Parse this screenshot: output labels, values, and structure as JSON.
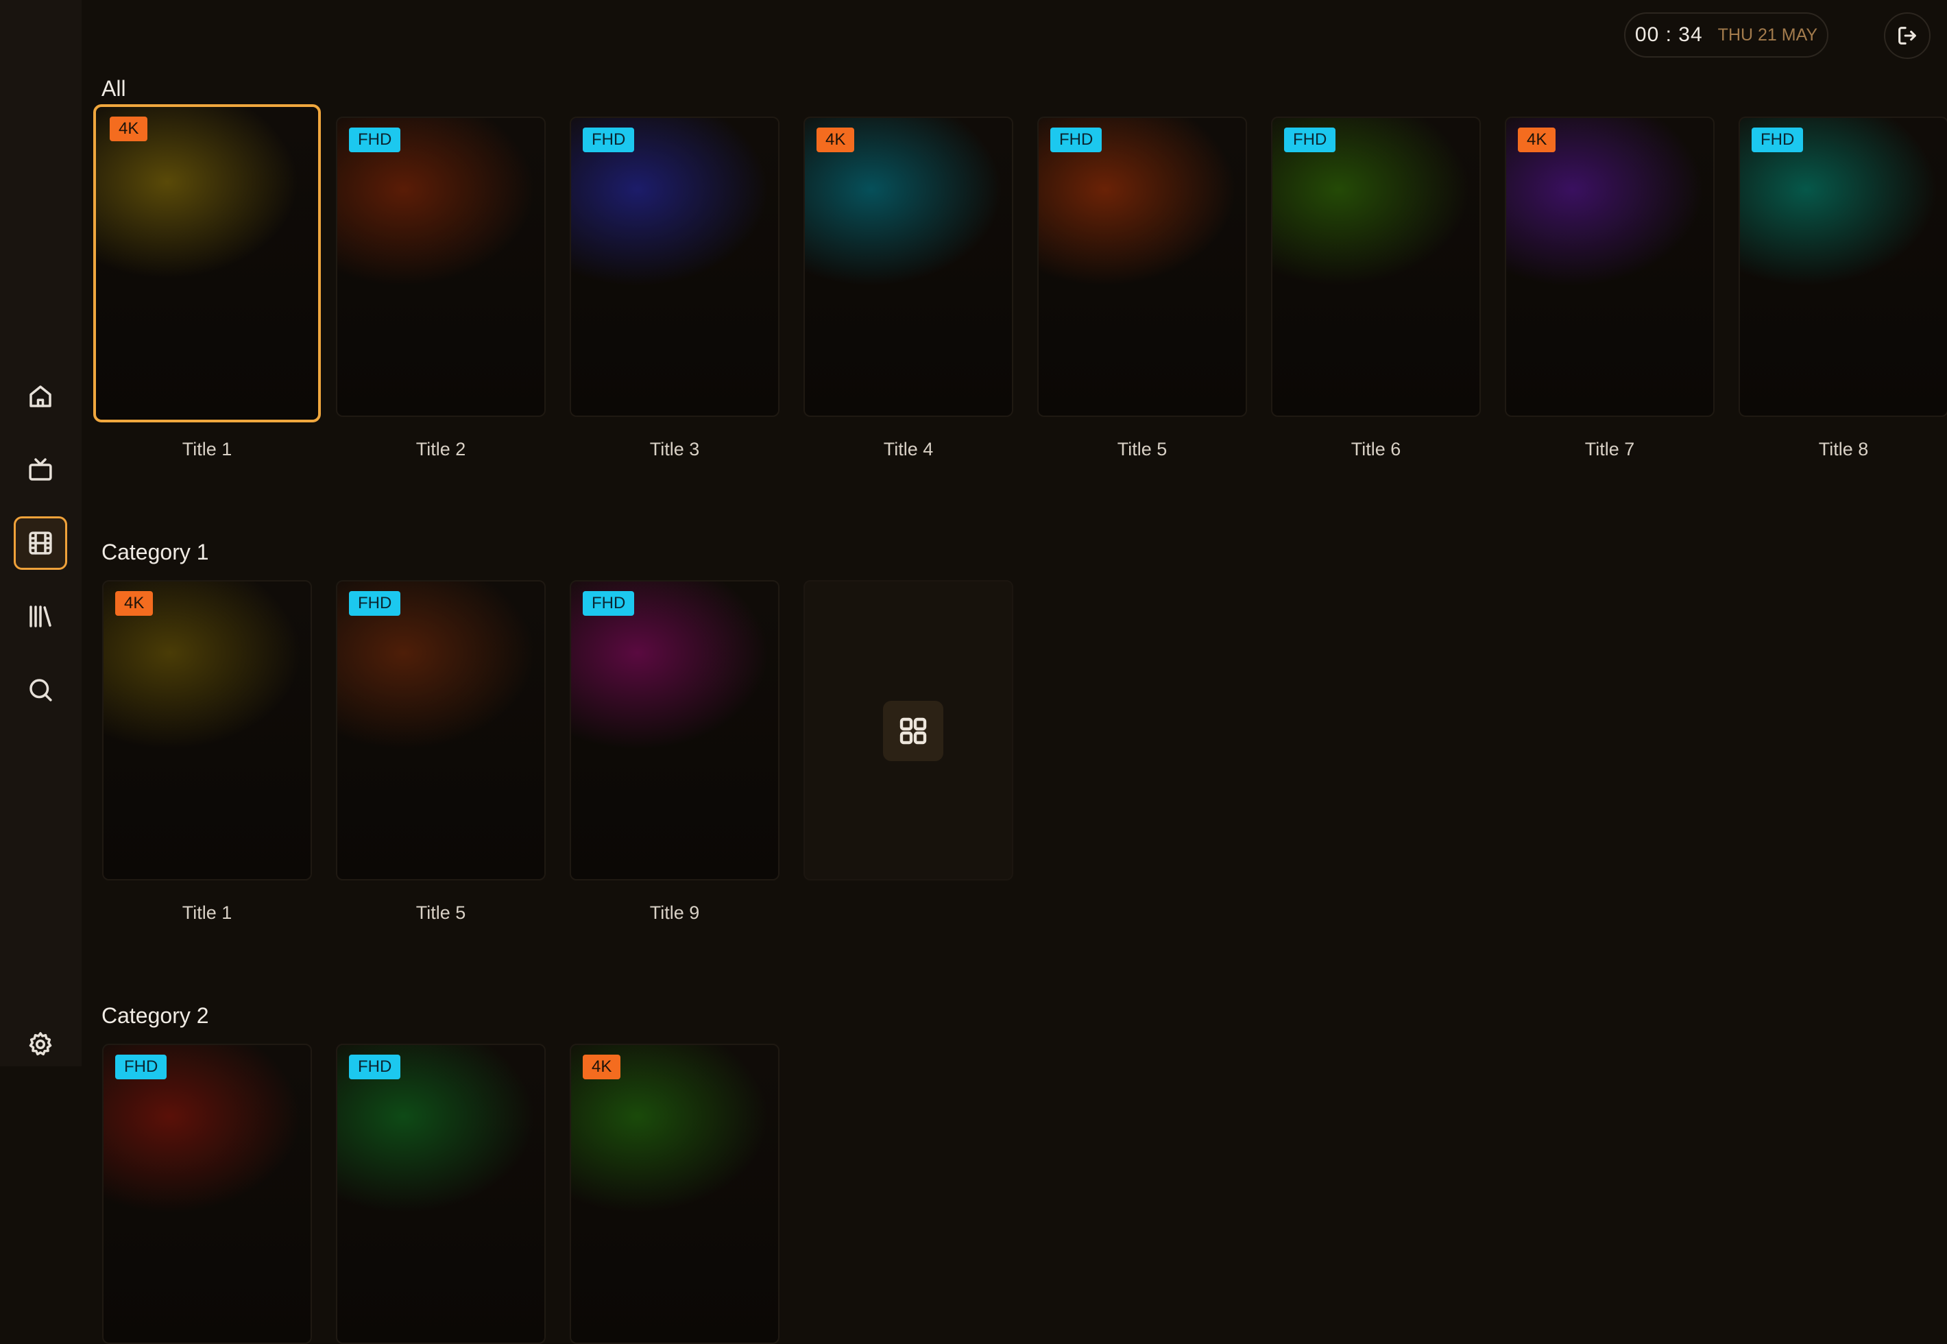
{
  "clock": {
    "time": "00 : 34",
    "date": "THU 21 MAY"
  },
  "sidebar": {
    "items": [
      {
        "name": "home",
        "icon": "home-icon",
        "active": false
      },
      {
        "name": "tv",
        "icon": "tv-icon",
        "active": false
      },
      {
        "name": "movies",
        "icon": "film-icon",
        "active": true
      },
      {
        "name": "library",
        "icon": "library-icon",
        "active": false
      },
      {
        "name": "search",
        "icon": "search-icon",
        "active": false
      }
    ],
    "settings_icon": "gear-icon"
  },
  "header": {
    "exit_icon": "exit-icon"
  },
  "colors": {
    "accent": "#f0a73e",
    "badge_4k": "#f46c1f",
    "badge_fhd": "#1cc8ef"
  },
  "sections": [
    {
      "title": "All",
      "cards": [
        {
          "title": "Title 1",
          "badge": "4K",
          "tint": "#5a4a08"
        },
        {
          "title": "Title 2",
          "badge": "FHD",
          "tint": "#5a1c06"
        },
        {
          "title": "Title 3",
          "badge": "FHD",
          "tint": "#1c1c6a"
        },
        {
          "title": "Title 4",
          "badge": "4K",
          "tint": "#06505a"
        },
        {
          "title": "Title 5",
          "badge": "FHD",
          "tint": "#6a2206"
        },
        {
          "title": "Title 6",
          "badge": "FHD",
          "tint": "#244a06"
        },
        {
          "title": "Title 7",
          "badge": "4K",
          "tint": "#3a1060"
        },
        {
          "title": "Title 8",
          "badge": "FHD",
          "tint": "#06584a"
        }
      ]
    },
    {
      "title": "Category 1",
      "cards": [
        {
          "title": "Title 1",
          "badge": "4K",
          "tint": "#4a3c06"
        },
        {
          "title": "Title 5",
          "badge": "FHD",
          "tint": "#4e1e08"
        },
        {
          "title": "Title 9",
          "badge": "FHD",
          "tint": "#5a0a40"
        }
      ],
      "more_icon": "grid-icon"
    },
    {
      "title": "Category 2",
      "cards": [
        {
          "title": "",
          "badge": "FHD",
          "tint": "#5a1008"
        },
        {
          "title": "",
          "badge": "FHD",
          "tint": "#0e4a16"
        },
        {
          "title": "",
          "badge": "4K",
          "tint": "#1a4a0a"
        }
      ]
    }
  ]
}
